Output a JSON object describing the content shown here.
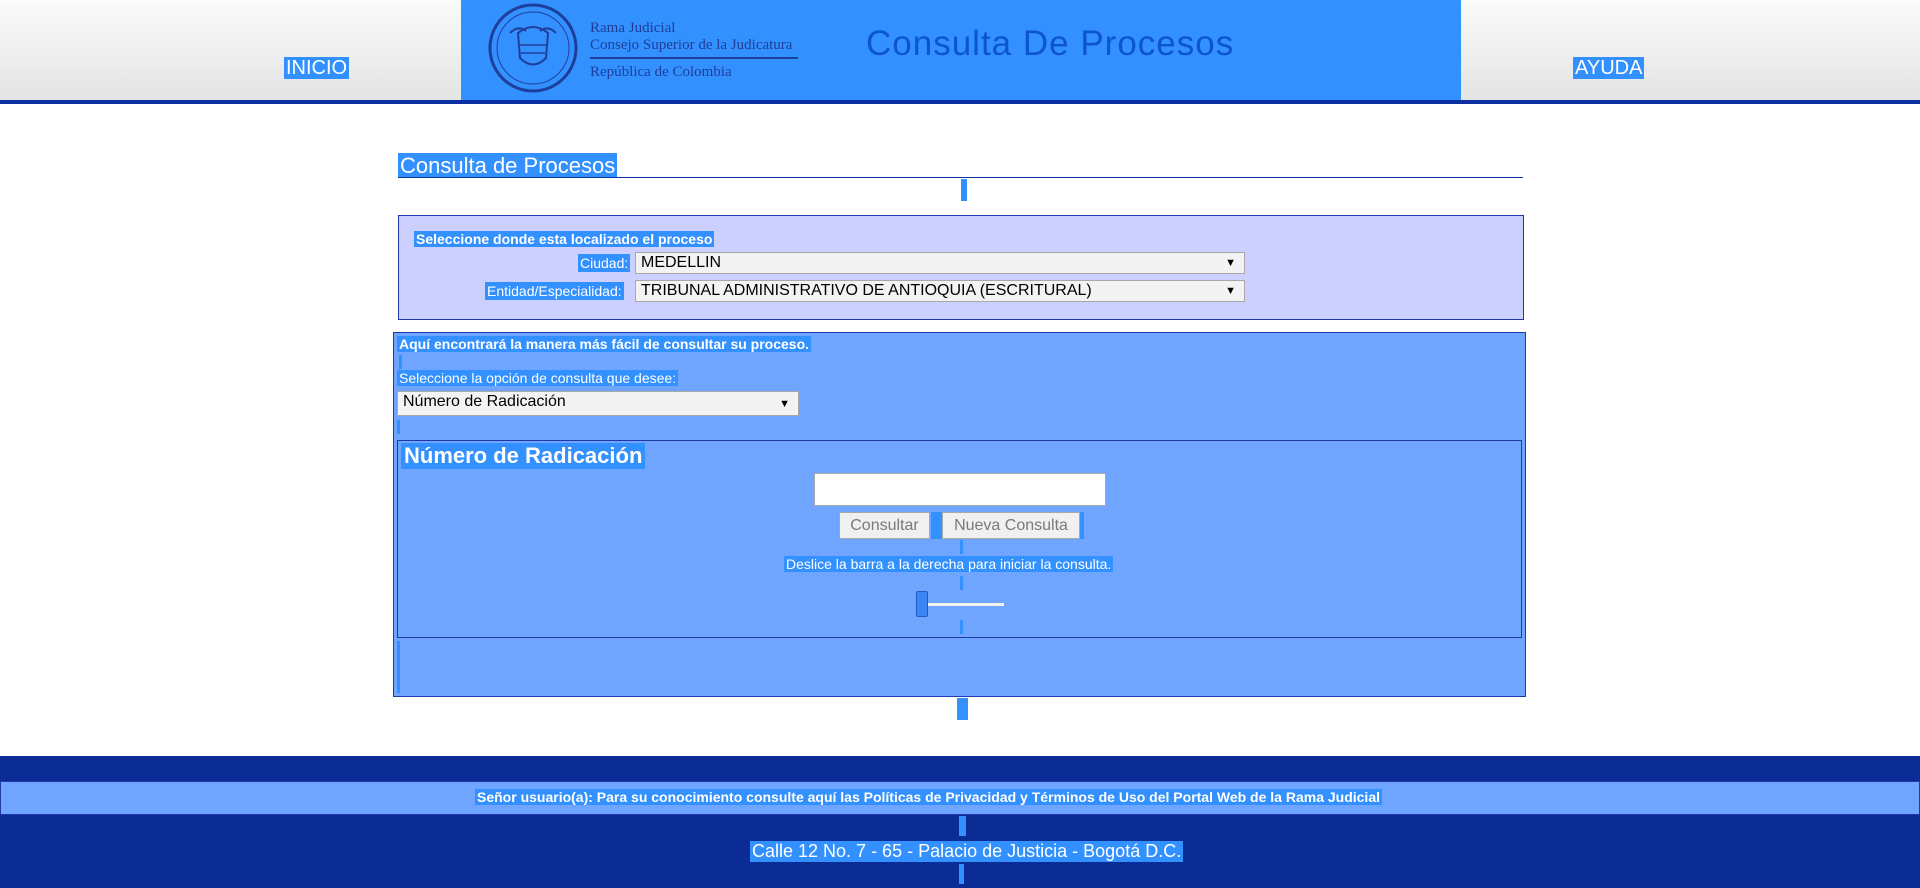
{
  "header": {
    "nav_inicio": "INICIO",
    "nav_ayuda": "AYUDA",
    "org_line1": "Rama Judicial",
    "org_line2": "Consejo Superior de la Judicatura",
    "org_line3": "República de Colombia",
    "banner_title": "Consulta De Procesos"
  },
  "page": {
    "title": "Consulta de Procesos"
  },
  "location": {
    "heading": "Seleccione donde esta localizado el proceso",
    "city_label": "Ciudad:",
    "city_value": "MEDELLIN",
    "entity_label": "Entidad/Especialidad:",
    "entity_value": "TRIBUNAL ADMINISTRATIVO DE ANTIOQUIA (ESCRITURAL)"
  },
  "query": {
    "intro": "Aquí encontrará la manera más fácil de consultar su proceso.",
    "option_label": "Seleccione la opción de consulta que desee:",
    "option_value": "Número de Radicación",
    "section_title": "Número de Radicación",
    "input_value": "",
    "consult_button": "Consultar",
    "new_query_button": "Nueva Consulta",
    "slide_instruction": "Deslice la barra a la derecha para iniciar la consulta.",
    "slider_level": 0
  },
  "footer": {
    "policy_text": "Señor usuario(a): Para su conocimiento consulte aquí las Políticas de Privacidad y Términos de Uso del Portal Web de la Rama Judicial",
    "address": "Calle 12 No. 7 - 65 - Palacio de Justicia - Bogotá D.C."
  },
  "icons": {
    "dropdown_arrow": "▼",
    "seal": "coat-of-arms-icon"
  },
  "colors": {
    "selection_blue": "#3390ff",
    "dark_navy": "#0a2c94",
    "panel_blue": "#6fa4ff",
    "location_lavender": "#ccd0ff"
  }
}
